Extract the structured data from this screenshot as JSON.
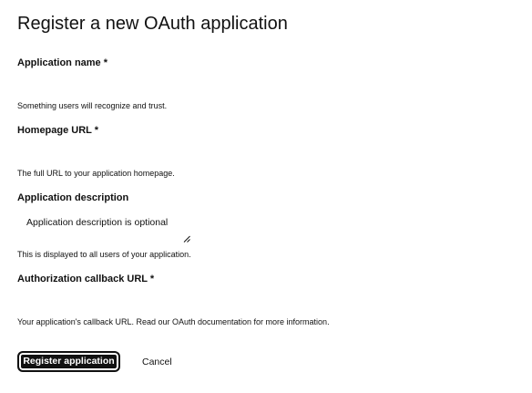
{
  "page": {
    "title": "Register a new OAuth application"
  },
  "form": {
    "application_name": {
      "label": "Application name",
      "required_mark": "*",
      "value": "",
      "hint": "Something users will recognize and trust."
    },
    "homepage_url": {
      "label": "Homepage URL",
      "required_mark": "*",
      "value": "",
      "hint": "The full URL to your application homepage."
    },
    "application_description": {
      "label": "Application description",
      "placeholder": "Application description is optional",
      "value": "",
      "hint": "This is displayed to all users of your application."
    },
    "callback_url": {
      "label": "Authorization callback URL",
      "required_mark": "*",
      "value": "",
      "hint": "Your application's callback URL. Read our OAuth documentation for more information."
    }
  },
  "actions": {
    "register_label": "Register application",
    "cancel_label": "Cancel"
  }
}
